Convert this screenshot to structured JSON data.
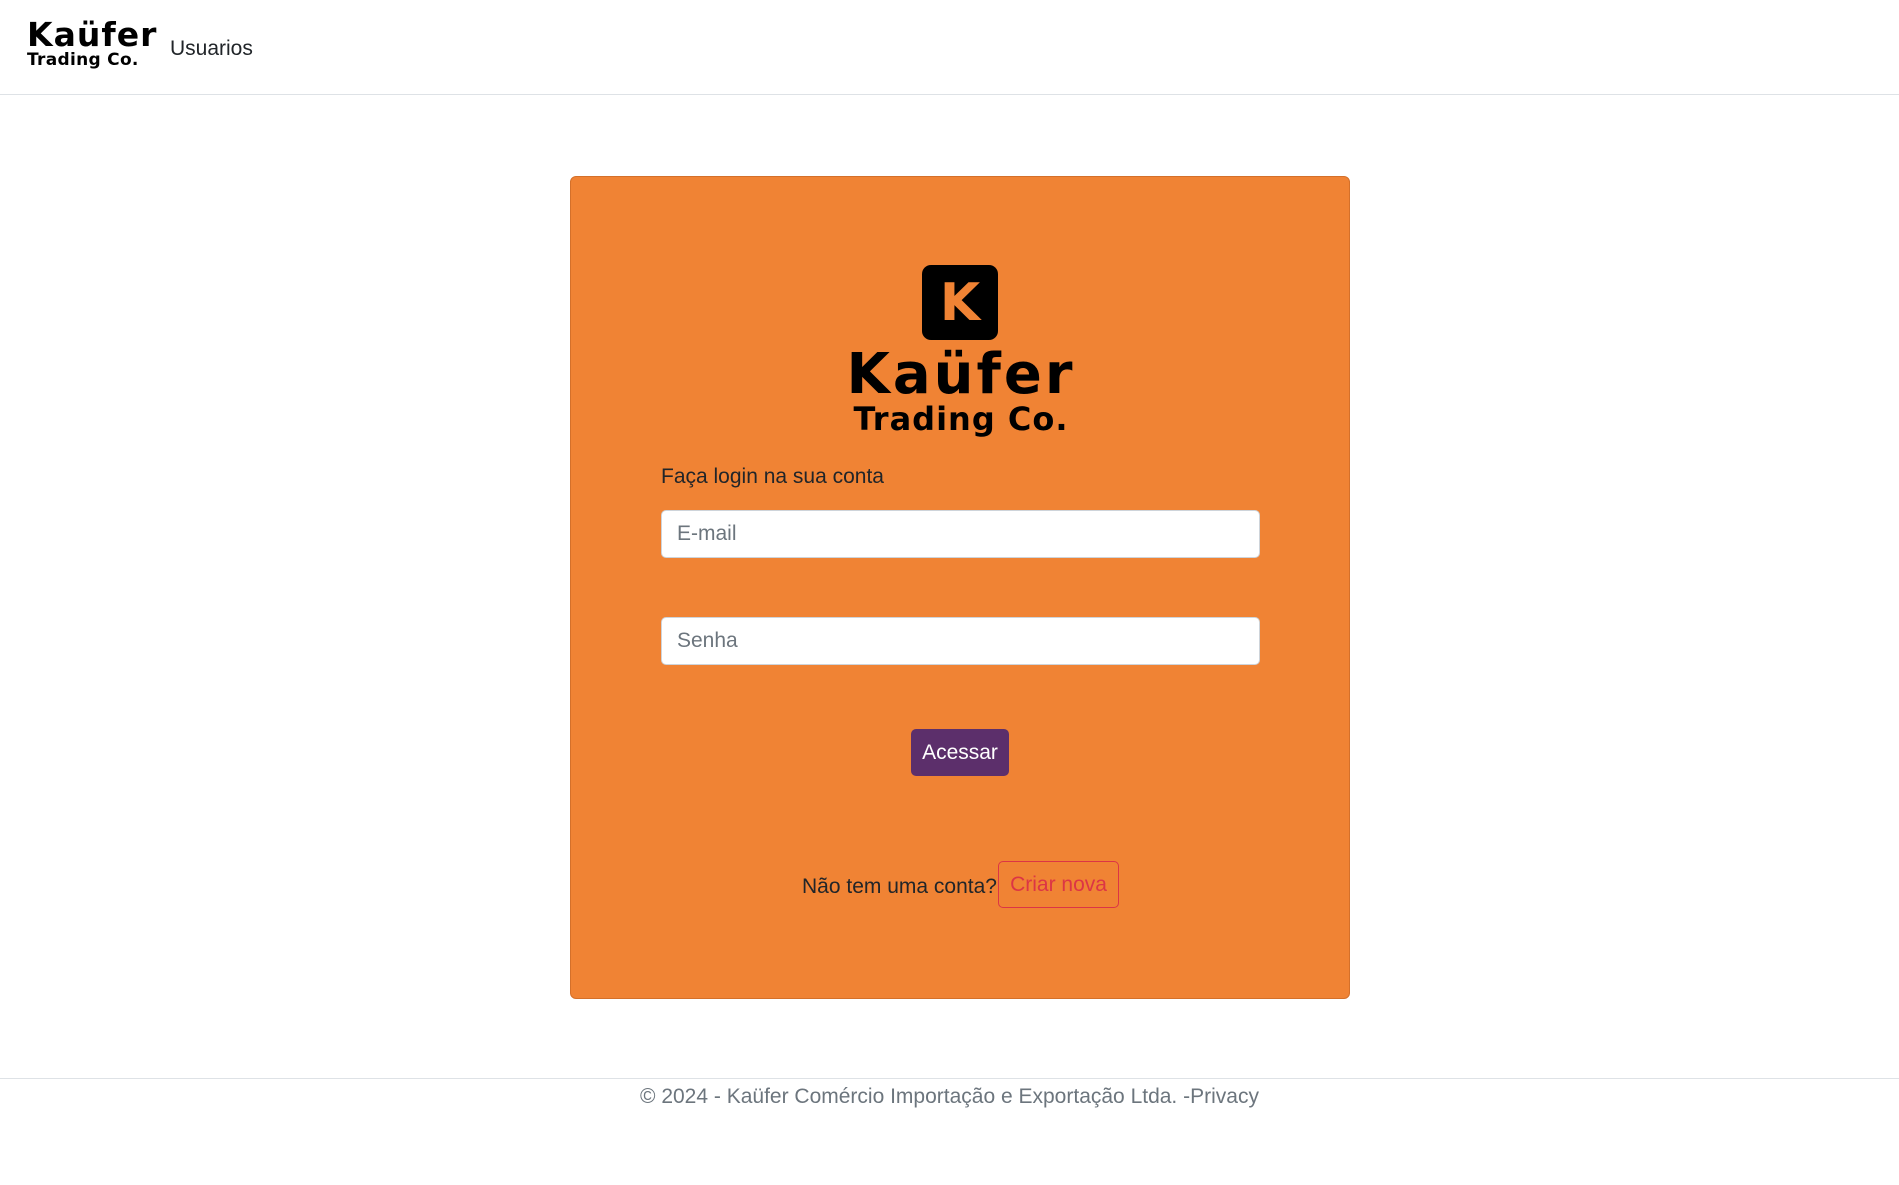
{
  "navbar": {
    "brand_line1": "Kaüfer",
    "brand_line2": "Trading Co.",
    "nav_link": "Usuarios"
  },
  "card": {
    "logo_letter": "K",
    "logo_line1": "Kaüfer",
    "logo_line2": "Trading Co.",
    "title": "Faça login na sua conta",
    "email_placeholder": "E-mail",
    "password_placeholder": "Senha",
    "submit_label": "Acessar",
    "signup_prompt": "Não tem uma conta?",
    "signup_button": "Criar nova"
  },
  "footer": {
    "copyright": "© 2024 - Kaüfer Comércio Importação e Exportação Ltda. -",
    "privacy_link": "Privacy"
  },
  "colors": {
    "card_background": "#f08334",
    "primary_button": "#5c2f6b",
    "outline_button": "#dc3545"
  }
}
